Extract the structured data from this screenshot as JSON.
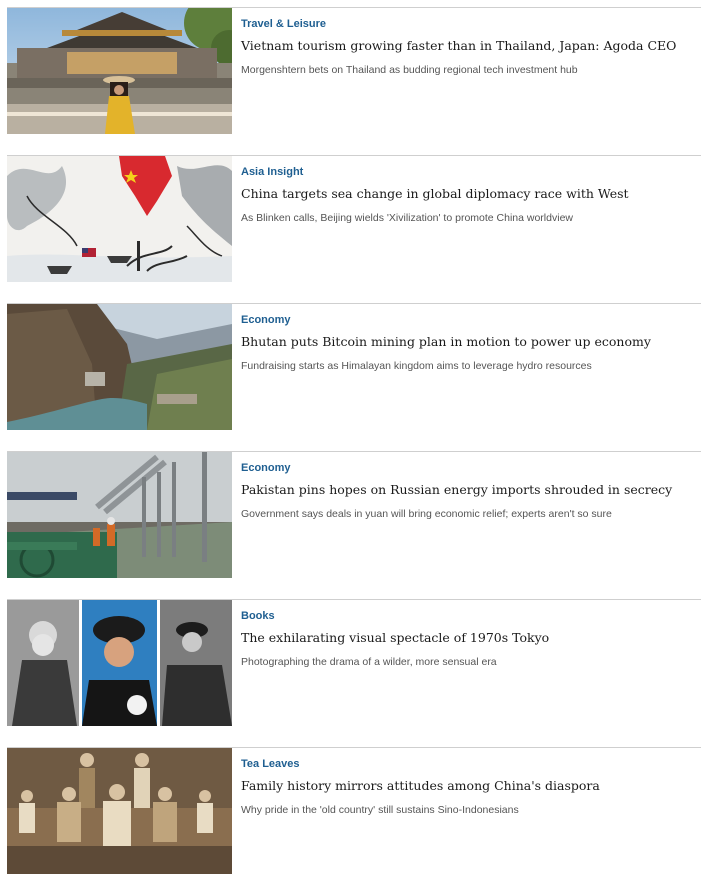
{
  "articles": [
    {
      "category": "Travel & Leisure",
      "headline": "Vietnam tourism growing faster than in Thailand, Japan: Agoda CEO",
      "dek": "Morgenshtern bets on Thailand as budding regional tech investment hub",
      "image_subject": "woman-in-ao-dai-at-imperial-citadel"
    },
    {
      "category": "Asia Insight",
      "headline": "China targets sea change in global diplomacy race with West",
      "dek": "As Blinken calls, Beijing wields 'Xivilization' to promote China worldview",
      "image_subject": "ink-painting-with-flags"
    },
    {
      "category": "Economy",
      "headline": "Bhutan puts Bitcoin mining plan in motion to power up economy",
      "dek": "Fundraising starts as Himalayan kingdom aims to leverage hydro resources",
      "image_subject": "himalayan-valley-hydro-dam"
    },
    {
      "category": "Economy",
      "headline": "Pakistan pins hopes on Russian energy imports shrouded in secrecy",
      "dek": "Government says deals in yuan will bring economic relief; experts aren't so sure",
      "image_subject": "oil-terminal-workers"
    },
    {
      "category": "Books",
      "headline": "The exhilarating visual spectacle of 1970s Tokyo",
      "dek": "Photographing the drama of a wilder, more sensual era",
      "image_subject": "1970s-tokyo-portraits-collage"
    },
    {
      "category": "Tea Leaves",
      "headline": "Family history mirrors attitudes among China's diaspora",
      "dek": "Why pride in the 'old country' still sustains Sino-Indonesians",
      "image_subject": "sepia-family-portrait"
    }
  ]
}
